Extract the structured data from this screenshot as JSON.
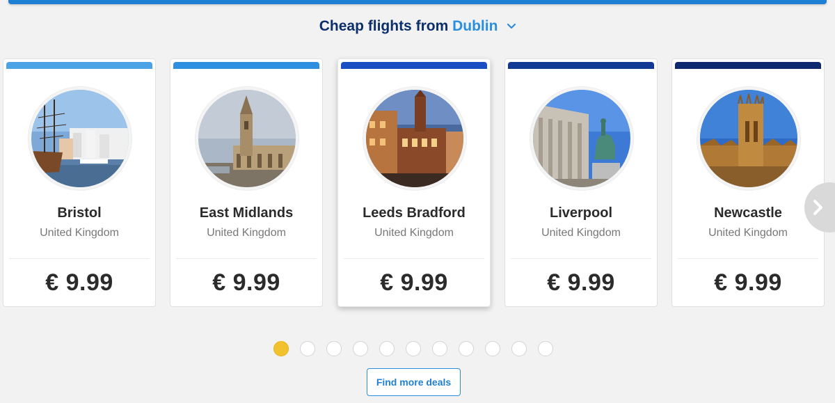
{
  "header": {
    "title_prefix": "Cheap flights from",
    "origin_city": "Dublin",
    "dropdown_icon": "chevron-down-icon"
  },
  "colors": {
    "heading": "#0b2f6b",
    "accent": "#2a8ee0",
    "active_dot": "#f2c12e"
  },
  "deals": [
    {
      "city": "Bristol",
      "country": "United Kingdom",
      "price": "€ 9.99",
      "stripe_color": "#4ba3e6",
      "photo": "harbour-photo"
    },
    {
      "city": "East Midlands",
      "country": "United Kingdom",
      "price": "€ 9.99",
      "stripe_color": "#2f8fe0",
      "photo": "church-photo"
    },
    {
      "city": "Leeds Bradford",
      "country": "United Kingdom",
      "price": "€ 9.99",
      "stripe_color": "#1a4fc4",
      "photo": "city-hall-photo"
    },
    {
      "city": "Liverpool",
      "country": "United Kingdom",
      "price": "€ 9.99",
      "stripe_color": "#123a94",
      "photo": "statue-photo"
    },
    {
      "city": "Newcastle",
      "country": "United Kingdom",
      "price": "€ 9.99",
      "stripe_color": "#0d2a6e",
      "photo": "cathedral-photo"
    }
  ],
  "carousel": {
    "next_icon": "chevron-right-icon",
    "page_count": 11,
    "active_page": 1
  },
  "actions": {
    "find_more_label": "Find more deals"
  }
}
